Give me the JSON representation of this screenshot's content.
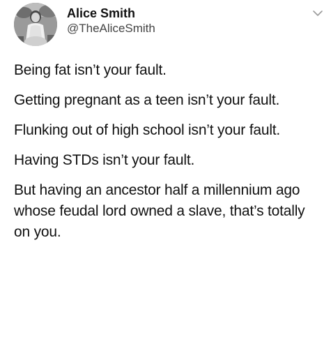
{
  "author": {
    "name": "Alice Smith",
    "handle": "@TheAliceSmith",
    "avatar_icon": "portrait-photo-avatar"
  },
  "menu_icon": "chevron-down-icon",
  "tweet": {
    "paragraphs": [
      "Being fat isn’t your fault.",
      "Getting pregnant as a teen isn’t your fault.",
      "Flunking out of high school isn’t your fault.",
      "Having STDs isn’t your fault.",
      "But having an ancestor half a millennium ago whose feudal lord owned a slave, that’s totally on you."
    ]
  }
}
